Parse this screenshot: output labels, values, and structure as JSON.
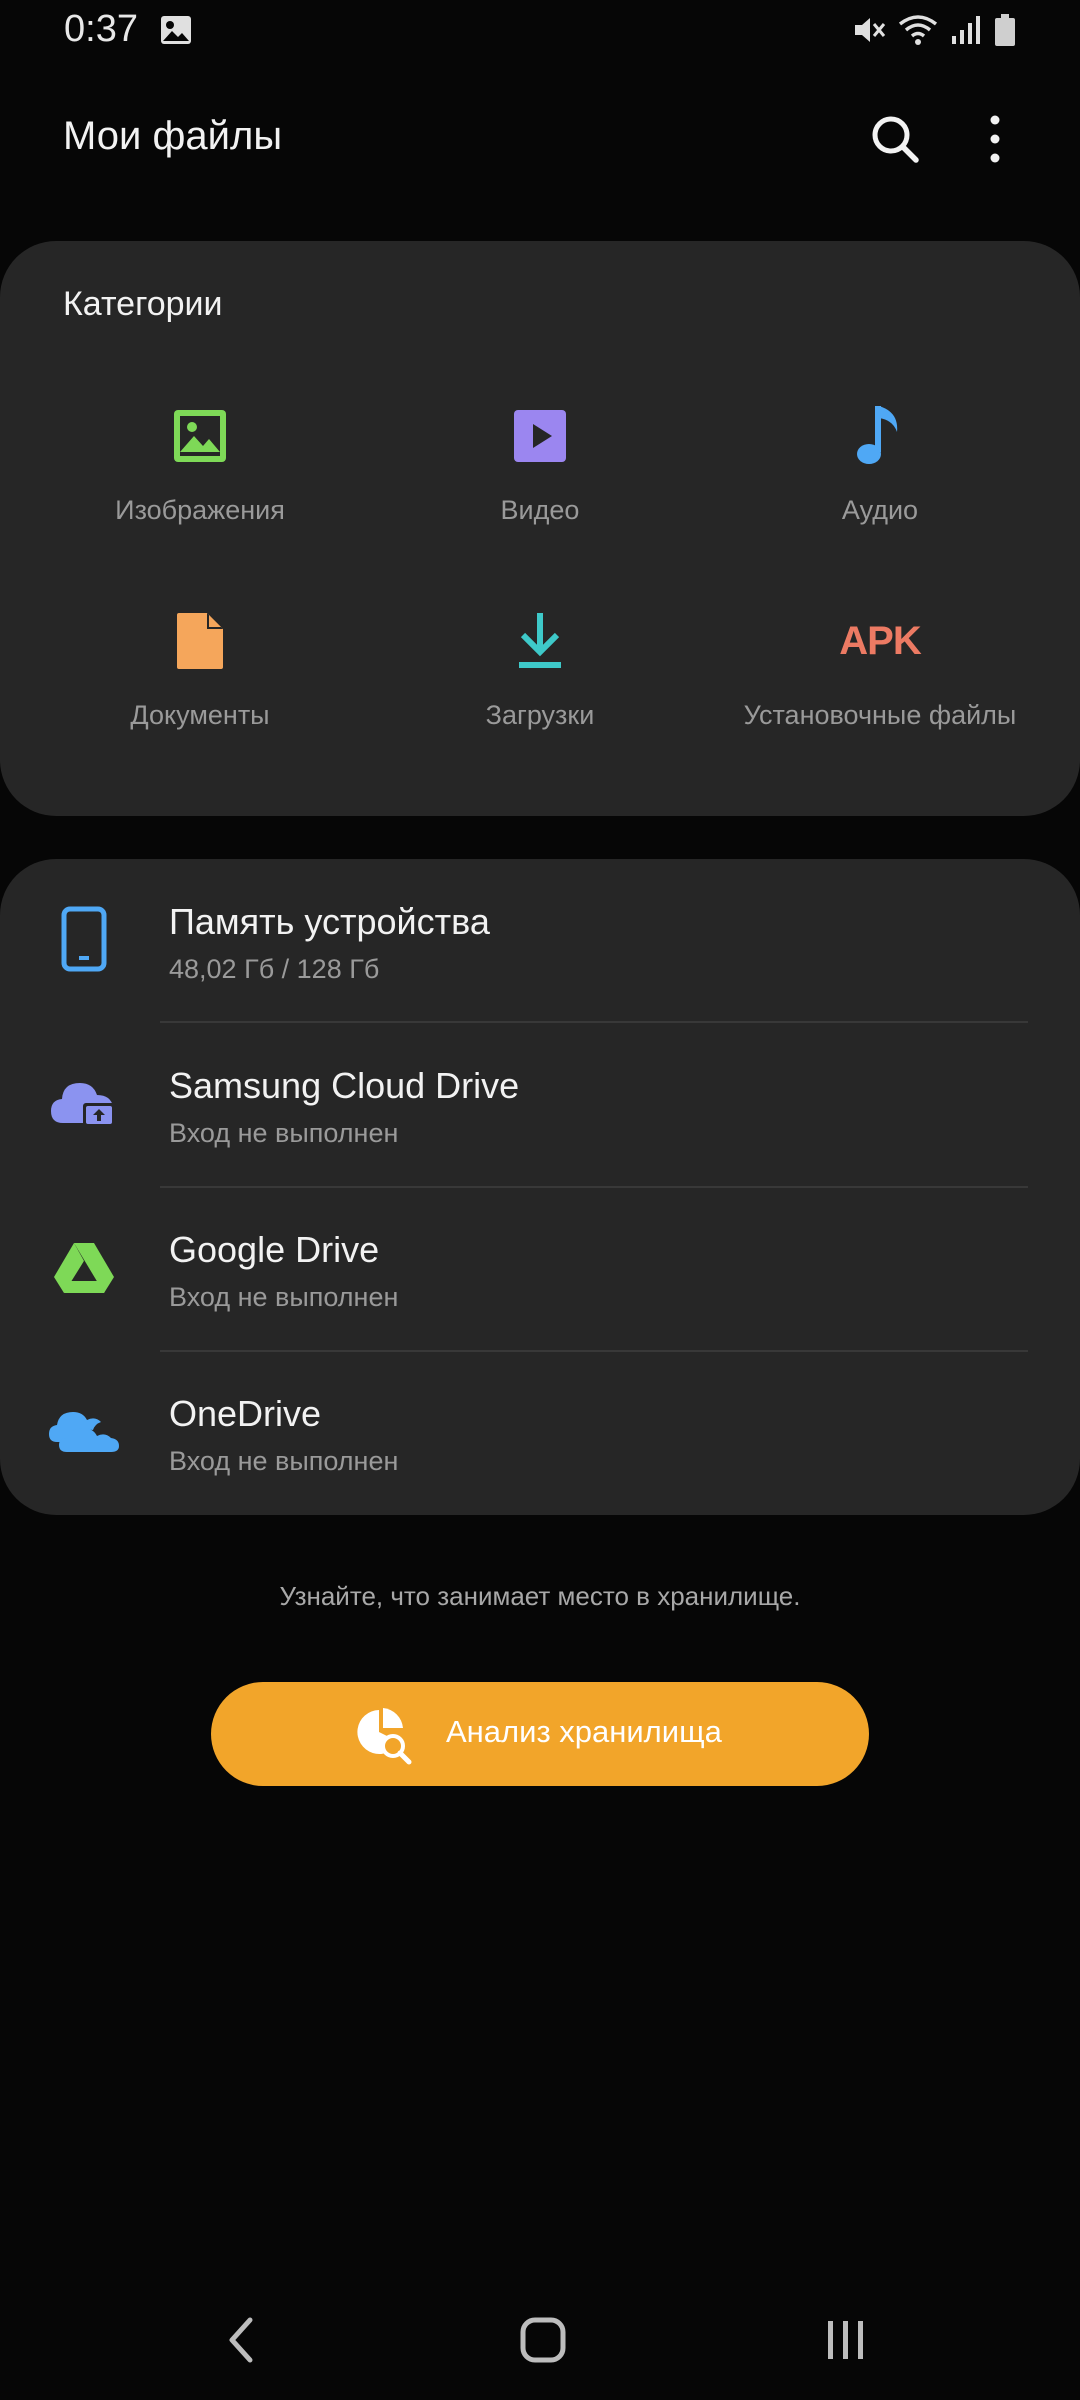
{
  "status_bar": {
    "time": "0:37",
    "icons": [
      "gallery-icon",
      "mute-icon",
      "wifi-icon",
      "signal-icon",
      "battery-icon"
    ]
  },
  "header": {
    "title": "Мои файлы",
    "actions": [
      "search-icon",
      "more-options-icon"
    ]
  },
  "categories": {
    "heading": "Категории",
    "items": [
      {
        "label": "Изображения",
        "icon": "image-icon",
        "color": "#7ed957"
      },
      {
        "label": "Видео",
        "icon": "video-icon",
        "color": "#9b86f0"
      },
      {
        "label": "Аудио",
        "icon": "music-note-icon",
        "color": "#4fa8f5"
      },
      {
        "label": "Документы",
        "icon": "document-icon",
        "color": "#f5a65b"
      },
      {
        "label": "Загрузки",
        "icon": "download-icon",
        "color": "#3ec9c9"
      },
      {
        "label": "Установочные файлы",
        "icon": "apk-icon",
        "icon_text": "APK",
        "color": "#ec7a63"
      }
    ]
  },
  "storage": {
    "items": [
      {
        "title": "Память устройства",
        "subtitle": "48,02 Гб / 128 Гб",
        "icon": "phone-icon",
        "color": "#4fa8f5"
      },
      {
        "title": "Samsung Cloud Drive",
        "subtitle": "Вход не выполнен",
        "icon": "samsung-cloud-icon",
        "color": "#8b93f0"
      },
      {
        "title": "Google Drive",
        "subtitle": "Вход не выполнен",
        "icon": "google-drive-icon",
        "color": "#7ed957"
      },
      {
        "title": "OneDrive",
        "subtitle": "Вход не выполнен",
        "icon": "onedrive-icon",
        "color": "#4fa8f5"
      }
    ]
  },
  "analysis": {
    "hint": "Узнайте, что занимает место в хранилище.",
    "button_label": "Анализ хранилища",
    "button_color": "#f2a52a"
  },
  "nav_bar": [
    "back-icon",
    "home-icon",
    "recent-apps-icon"
  ]
}
